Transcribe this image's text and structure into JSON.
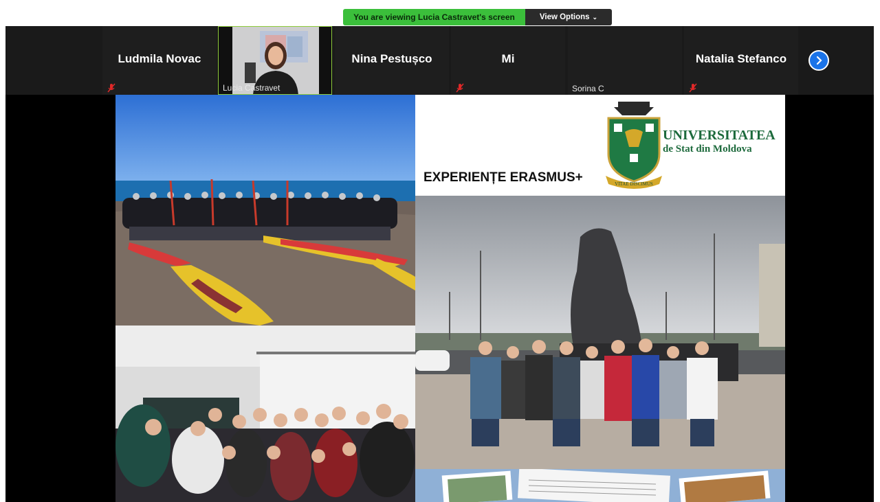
{
  "banner": {
    "message": "You are viewing Lucia Castravet's screen",
    "options_label": "View Options",
    "color_bg": "#3bbf3b"
  },
  "participants": [
    {
      "name": "Ludmila Novac",
      "muted": true,
      "video": false
    },
    {
      "name": "Lucia Castravet",
      "muted": false,
      "video": true,
      "active_speaker": true
    },
    {
      "name": "Nina Pestușco",
      "muted": false,
      "video": false
    },
    {
      "name": "Mi",
      "muted": true,
      "video": false
    },
    {
      "name": "Sorina C",
      "muted": false,
      "video": false
    },
    {
      "name": "Natalia Stefanco",
      "muted": true,
      "video": false
    }
  ],
  "next_page_icon": "chevron-right-icon",
  "slide": {
    "title": "EXPERIENȚE ERASMUS+",
    "university_line1": "UNIVERSITATEA",
    "university_line2": "de Stat din Moldova",
    "motto": "VITAE DISCIMUS"
  }
}
